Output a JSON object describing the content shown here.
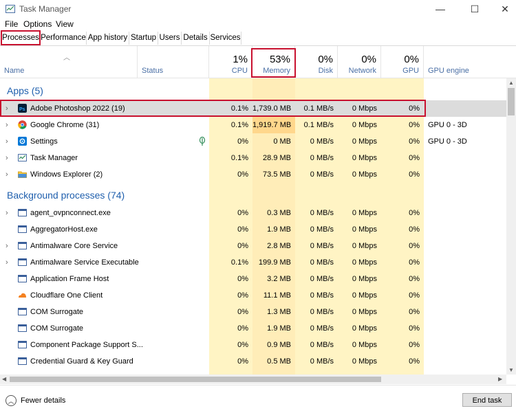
{
  "window": {
    "title": "Task Manager",
    "minimize": "—",
    "maximize": "☐",
    "close": "✕"
  },
  "menu": [
    "File",
    "Options",
    "View"
  ],
  "tabs": [
    "Processes",
    "Performance",
    "App history",
    "Startup",
    "Users",
    "Details",
    "Services"
  ],
  "header": {
    "name": "Name",
    "status": "Status",
    "cpu_pct": "1%",
    "cpu": "CPU",
    "mem_pct": "53%",
    "mem": "Memory",
    "disk_pct": "0%",
    "disk": "Disk",
    "net_pct": "0%",
    "net": "Network",
    "gpu_pct": "0%",
    "gpu": "GPU",
    "gpu_engine": "GPU engine"
  },
  "groups": {
    "apps": "Apps (5)",
    "background": "Background processes (74)"
  },
  "apps": [
    {
      "name": "Adobe Photoshop 2022 (19)",
      "cpu": "0.1%",
      "mem": "1,739.0 MB",
      "disk": "0.1 MB/s",
      "net": "0 Mbps",
      "gpu": "0%",
      "engine": ""
    },
    {
      "name": "Google Chrome (31)",
      "cpu": "0.1%",
      "mem": "1,919.7 MB",
      "disk": "0.1 MB/s",
      "net": "0 Mbps",
      "gpu": "0%",
      "engine": "GPU 0 - 3D"
    },
    {
      "name": "Settings",
      "cpu": "0%",
      "mem": "0 MB",
      "disk": "0 MB/s",
      "net": "0 Mbps",
      "gpu": "0%",
      "engine": "GPU 0 - 3D"
    },
    {
      "name": "Task Manager",
      "cpu": "0.1%",
      "mem": "28.9 MB",
      "disk": "0 MB/s",
      "net": "0 Mbps",
      "gpu": "0%",
      "engine": ""
    },
    {
      "name": "Windows Explorer (2)",
      "cpu": "0%",
      "mem": "73.5 MB",
      "disk": "0 MB/s",
      "net": "0 Mbps",
      "gpu": "0%",
      "engine": ""
    }
  ],
  "background": [
    {
      "name": "agent_ovpnconnect.exe",
      "cpu": "0%",
      "mem": "0.3 MB",
      "disk": "0 MB/s",
      "net": "0 Mbps",
      "gpu": "0%"
    },
    {
      "name": "AggregatorHost.exe",
      "cpu": "0%",
      "mem": "1.9 MB",
      "disk": "0 MB/s",
      "net": "0 Mbps",
      "gpu": "0%"
    },
    {
      "name": "Antimalware Core Service",
      "cpu": "0%",
      "mem": "2.8 MB",
      "disk": "0 MB/s",
      "net": "0 Mbps",
      "gpu": "0%"
    },
    {
      "name": "Antimalware Service Executable",
      "cpu": "0.1%",
      "mem": "199.9 MB",
      "disk": "0 MB/s",
      "net": "0 Mbps",
      "gpu": "0%"
    },
    {
      "name": "Application Frame Host",
      "cpu": "0%",
      "mem": "3.2 MB",
      "disk": "0 MB/s",
      "net": "0 Mbps",
      "gpu": "0%"
    },
    {
      "name": "Cloudflare One Client",
      "cpu": "0%",
      "mem": "11.1 MB",
      "disk": "0 MB/s",
      "net": "0 Mbps",
      "gpu": "0%"
    },
    {
      "name": "COM Surrogate",
      "cpu": "0%",
      "mem": "1.3 MB",
      "disk": "0 MB/s",
      "net": "0 Mbps",
      "gpu": "0%"
    },
    {
      "name": "COM Surrogate",
      "cpu": "0%",
      "mem": "1.9 MB",
      "disk": "0 MB/s",
      "net": "0 Mbps",
      "gpu": "0%"
    },
    {
      "name": "Component Package Support S...",
      "cpu": "0%",
      "mem": "0.9 MB",
      "disk": "0 MB/s",
      "net": "0 Mbps",
      "gpu": "0%"
    },
    {
      "name": "Credential Guard & Key Guard",
      "cpu": "0%",
      "mem": "0.5 MB",
      "disk": "0 MB/s",
      "net": "0 Mbps",
      "gpu": "0%"
    }
  ],
  "footer": {
    "fewer_details": "Fewer details",
    "end_task": "End task"
  }
}
